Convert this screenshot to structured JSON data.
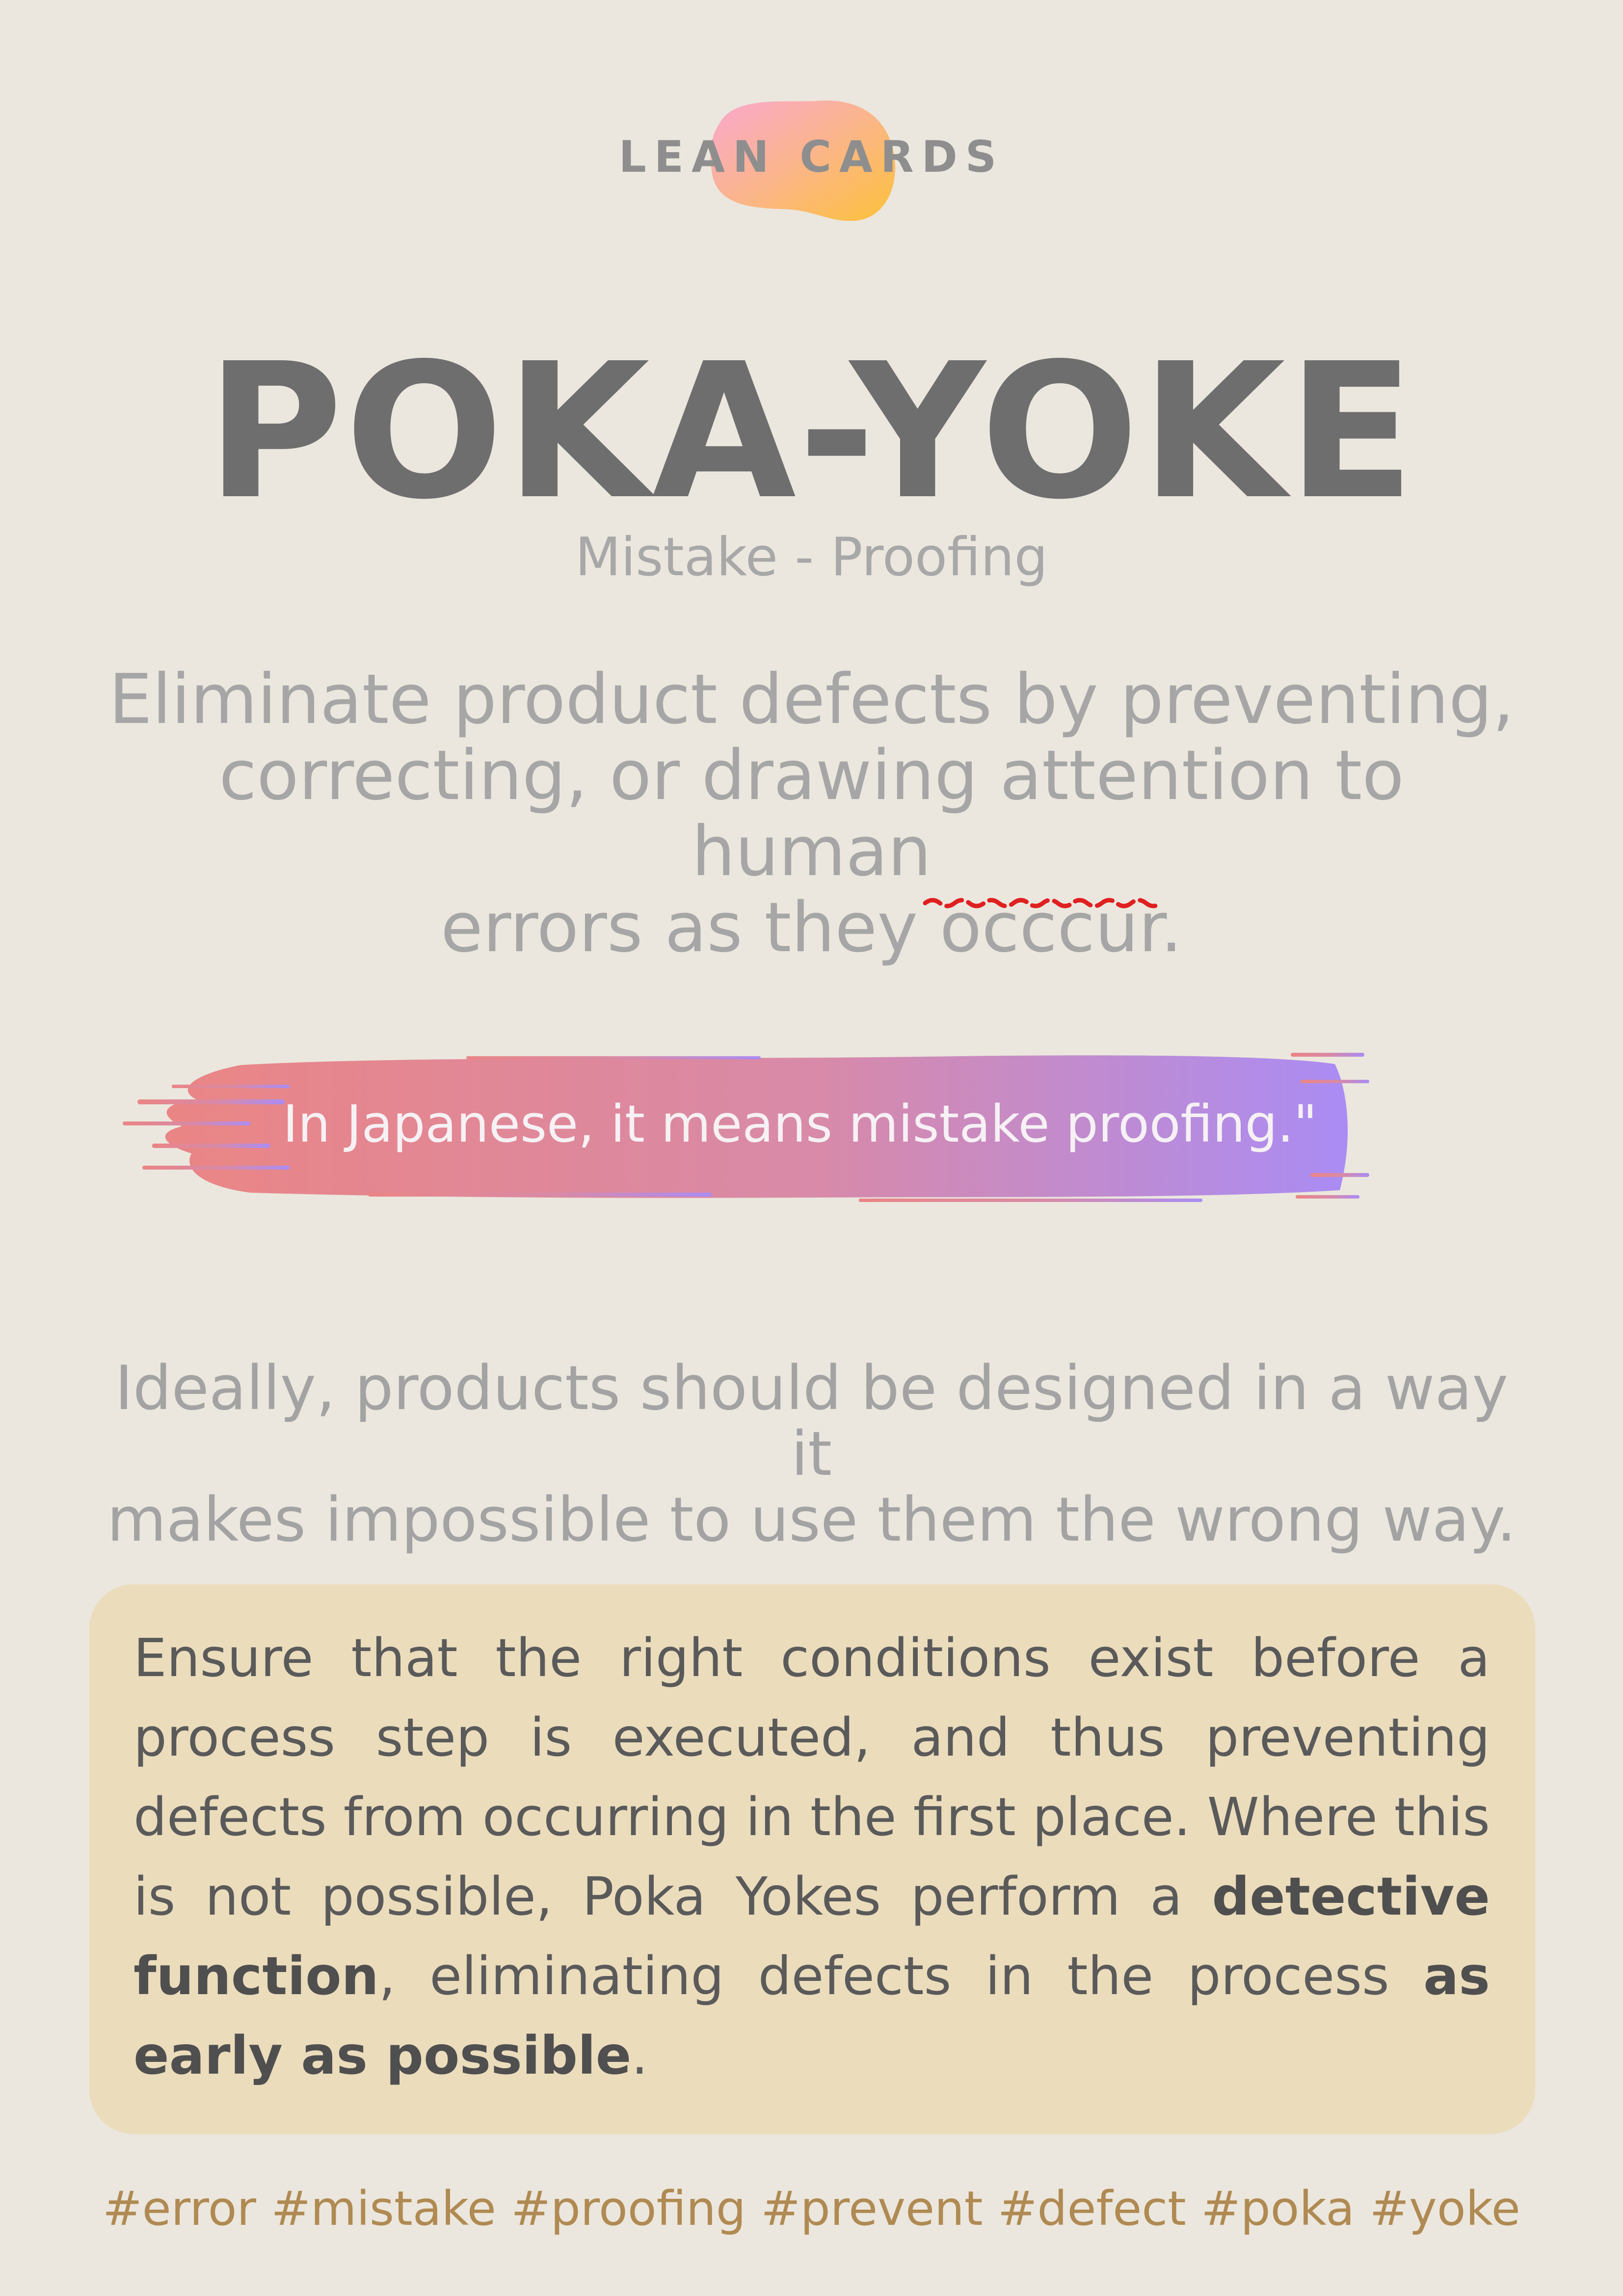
{
  "brand": {
    "name": "LEAN CARDS"
  },
  "card": {
    "title": "POKA-YOKE",
    "subtitle": "Mistake - Proofing",
    "definition_lines": [
      "Eliminate product defects by preventing,",
      "correcting, or drawing attention to human",
      "errors as they occcur."
    ],
    "banner_quote": "In Japanese, it means mistake proofing.\"",
    "ideal_lines": [
      "Ideally, products should be designed in a way it",
      "makes impossible to use them the wrong way."
    ],
    "info": {
      "part1": "Ensure that the right conditions exist before a process step is executed, and thus preventing defects from occurring in the first place. Where this is not possible, Poka Yokes perform a ",
      "bold1": "detective function",
      "part2": ", eliminating defects in the process ",
      "bold2": "as early as possible",
      "part3": "."
    },
    "tags": "#error #mistake #proofing #prevent #defect #poka #yoke"
  },
  "colors": {
    "background": "#ebe7de",
    "title": "#6e6e6e",
    "info_box": "#ebdcbc",
    "tag": "#b08a52",
    "brush_start": "#ea8585",
    "brush_end": "#aa8cf4",
    "spellcheck": "#e02020"
  }
}
